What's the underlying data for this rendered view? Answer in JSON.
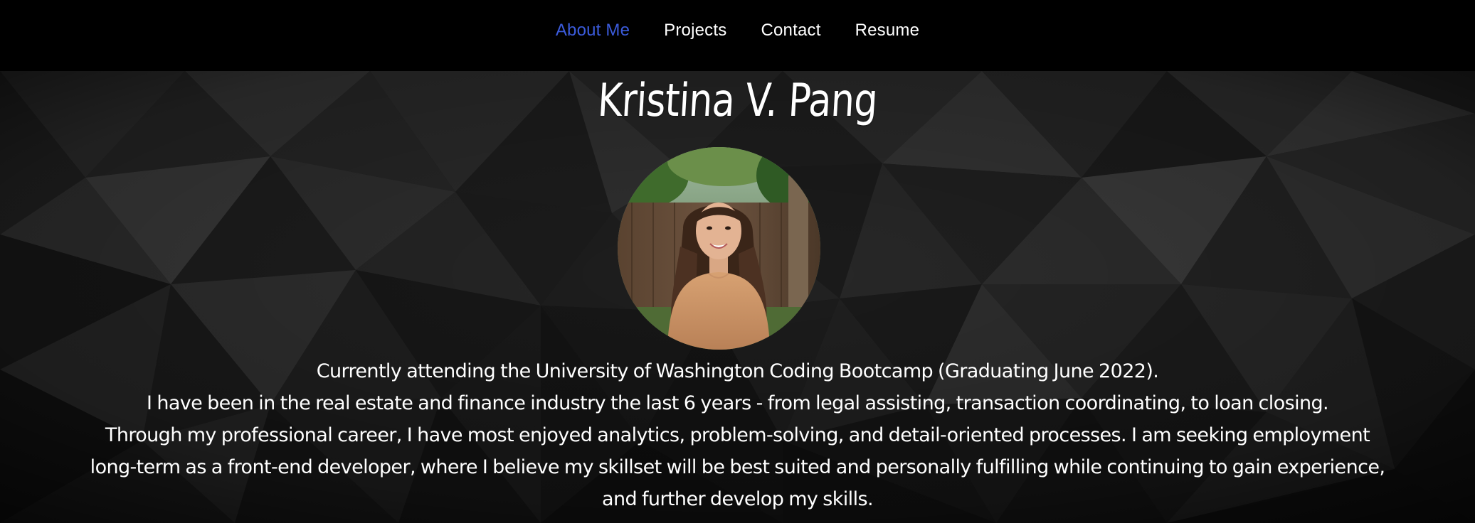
{
  "nav": {
    "items": [
      {
        "label": "About Me",
        "active": true
      },
      {
        "label": "Projects",
        "active": false
      },
      {
        "label": "Contact",
        "active": false
      },
      {
        "label": "Resume",
        "active": false
      }
    ]
  },
  "hero": {
    "name": "Kristina V. Pang",
    "bio_line1": "Currently attending the University of Washington Coding Bootcamp (Graduating June 2022).",
    "bio_line2": "I have been in the real estate and finance industry the last 6 years - from legal assisting, transaction coordinating, to loan closing.",
    "bio_line3": "Through my professional career, I have most enjoyed analytics, problem-solving, and detail-oriented processes. I am seeking employment long-term as a front-end developer, where I believe my skillset will be best suited and personally fulfilling while continuing to gain experience, and further develop my skills."
  },
  "colors": {
    "nav_background": "#000000",
    "nav_text": "#ffffff",
    "nav_active": "#3b5bdb",
    "hero_text": "#ffffff"
  }
}
